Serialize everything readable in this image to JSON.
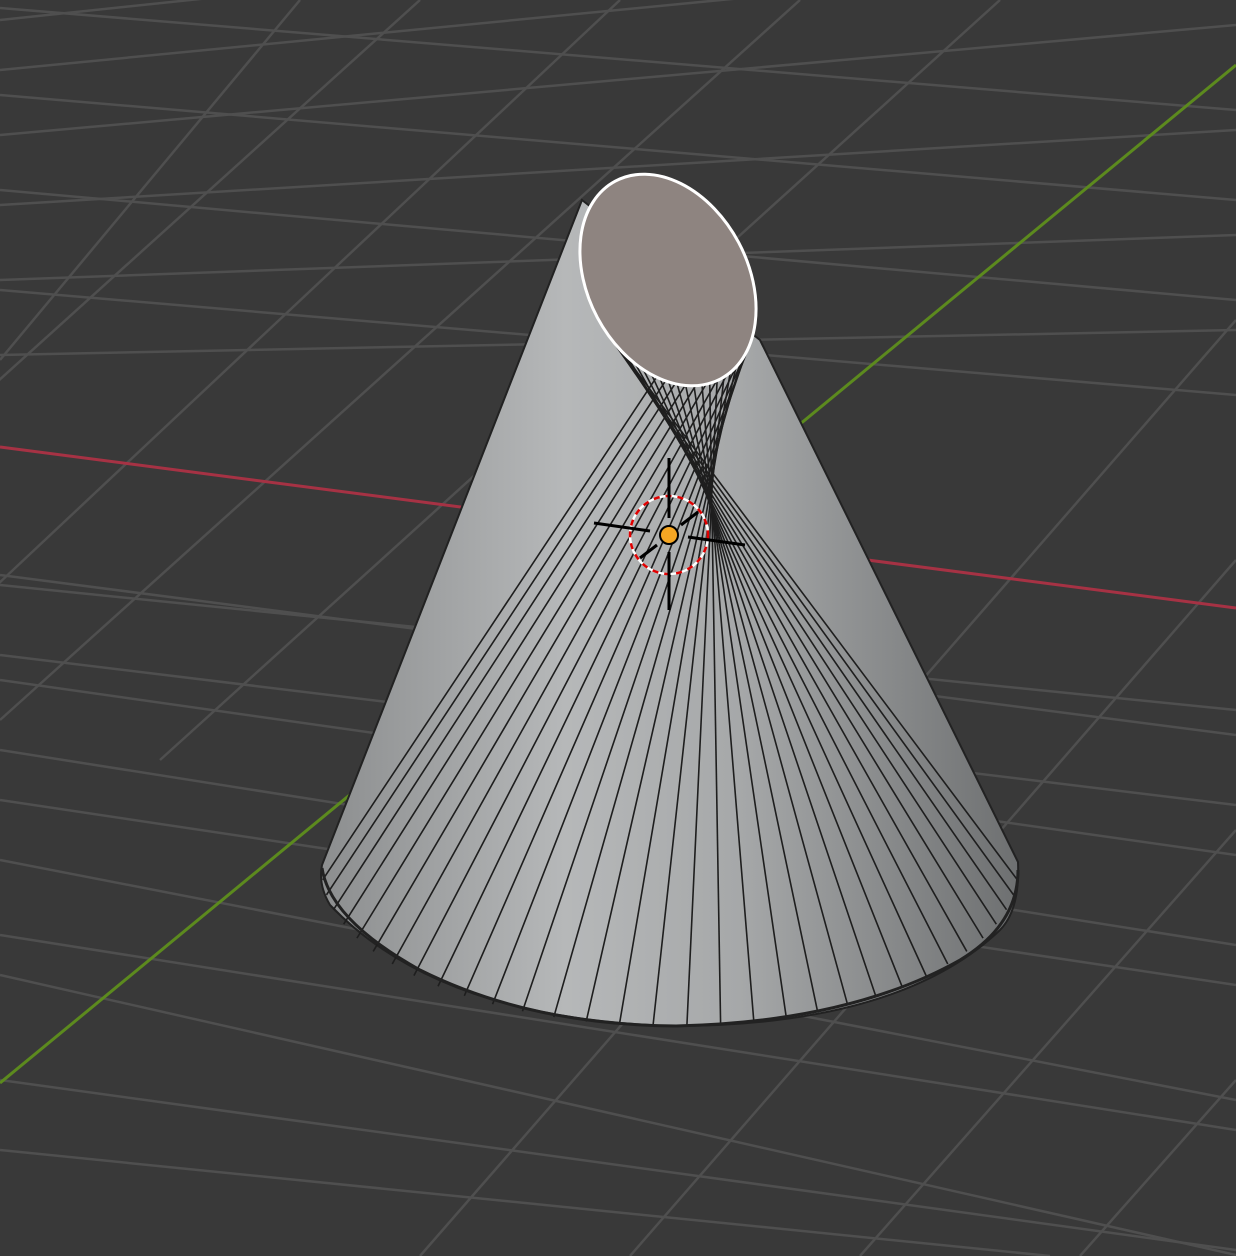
{
  "viewport": {
    "background_color": "#393939",
    "grid_color": "#4d4d4d",
    "x_axis_color": "#c0394f",
    "y_axis_color": "#6a9a23"
  },
  "object": {
    "type": "cone",
    "state": "selected-face",
    "side_color": "#a7a9aa",
    "edge_color": "#1c1c1c",
    "selected_face_color": "#8e8480",
    "selected_outline_color": "#ffffff",
    "segments": 32
  },
  "cursor_3d": {
    "icon": "3d-cursor-icon",
    "ring_colors": [
      "#ff0000",
      "#ffffff"
    ],
    "crosshair_color": "#000000"
  },
  "origin": {
    "icon": "object-origin-dot",
    "color": "#f5a623"
  }
}
